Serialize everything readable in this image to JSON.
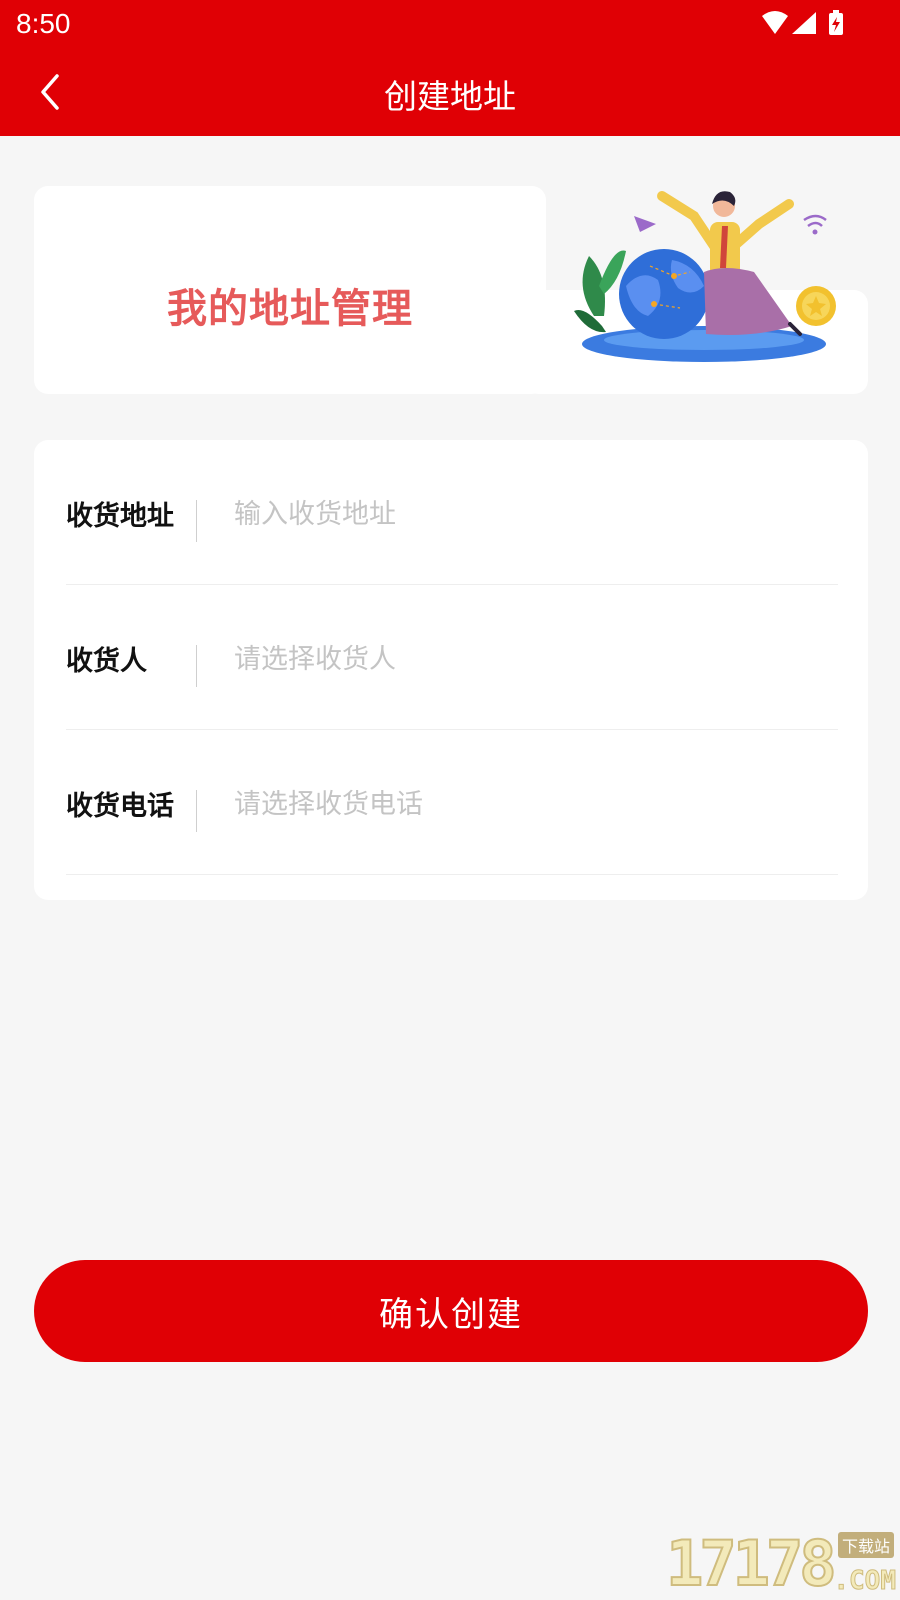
{
  "status_bar": {
    "time": "8:50",
    "icons": [
      "wifi-icon",
      "signal-icon",
      "battery-charging-icon"
    ]
  },
  "app_bar": {
    "back_icon": "chevron-left-icon",
    "title": "创建地址"
  },
  "banner": {
    "title": "我的地址管理",
    "illustration": "person-globe-illustration"
  },
  "form": {
    "fields": [
      {
        "label": "收货地址",
        "placeholder": "输入收货地址",
        "value": ""
      },
      {
        "label": "收货人",
        "placeholder": "请选择收货人",
        "value": ""
      },
      {
        "label": "收货电话",
        "placeholder": "请选择收货电话",
        "value": ""
      }
    ]
  },
  "confirm_button": {
    "label": "确认创建"
  },
  "watermark": {
    "digits": "17178",
    "tag": "下载站",
    "suffix": ".COM"
  },
  "colors": {
    "primary": "#e00005",
    "banner_title": "#e65a5a",
    "background": "#f6f6f6",
    "placeholder": "#c4c4c4"
  }
}
